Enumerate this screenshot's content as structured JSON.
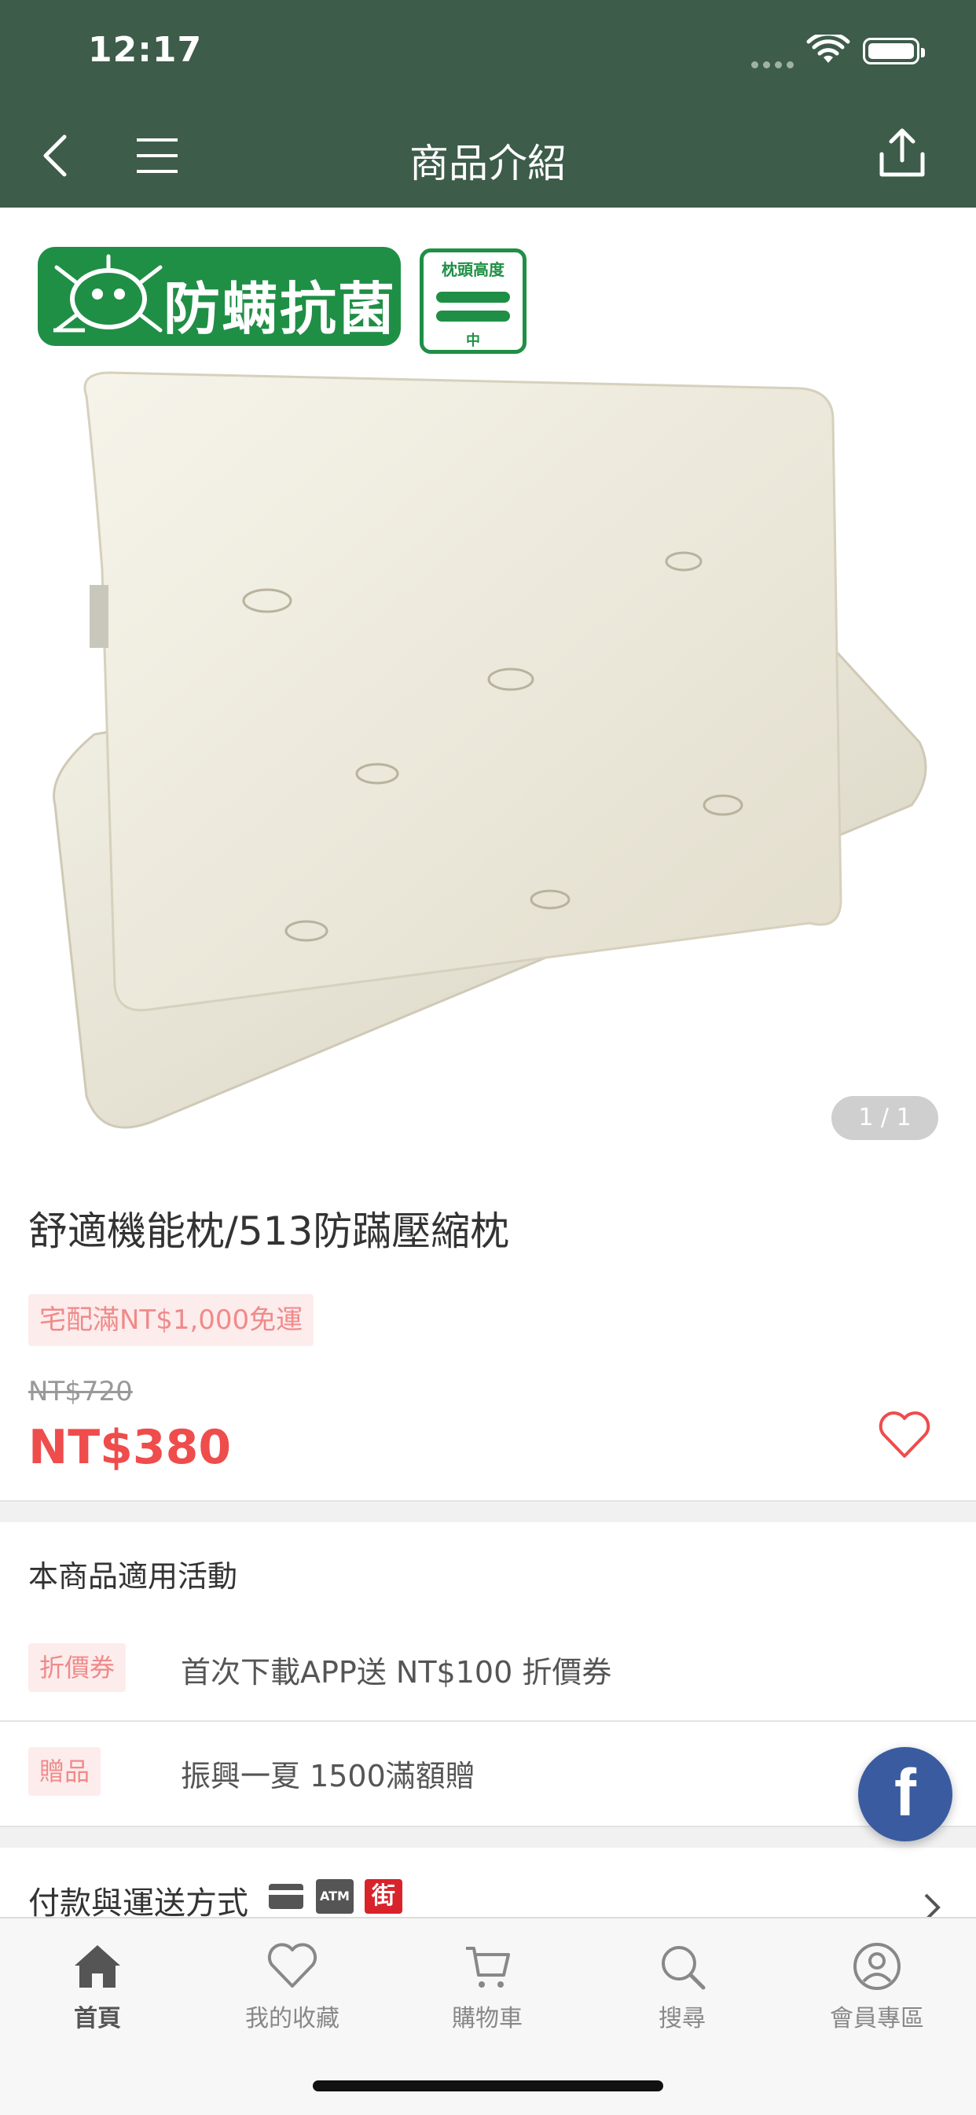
{
  "status_bar": {
    "time": "12:17"
  },
  "nav": {
    "title": "商品介紹",
    "icons": [
      "back-arrow-icon",
      "menu-icon",
      "share-icon"
    ]
  },
  "hero": {
    "badge_text": "防螨抗菌",
    "height_badge_title": "枕頭高度",
    "height_badge_value": "中",
    "page_indicator": "1 / 1"
  },
  "product": {
    "title": "舒適機能枕/513防蹣壓縮枕",
    "shipping_tag": "宅配滿NT$1,000免運",
    "original_price": "NT$720",
    "sale_price": "NT$380"
  },
  "promotions": {
    "header": "本商品適用活動",
    "items": [
      {
        "tag": "折價券",
        "text": "首次下載APP送 NT$100 折價券"
      },
      {
        "tag": "贈品",
        "text": "振興一夏 1500滿額贈"
      }
    ]
  },
  "payment": {
    "label": "付款與運送方式",
    "icons": [
      "credit-card-icon",
      "atm-icon",
      "street-store-icon"
    ],
    "atm_text": "ATM",
    "store_text": "街"
  },
  "facebook": {
    "letter": "f"
  },
  "tabbar": {
    "items": [
      {
        "label": "首頁",
        "icon": "home-icon",
        "active": true
      },
      {
        "label": "我的收藏",
        "icon": "heart-icon"
      },
      {
        "label": "購物車",
        "icon": "cart-icon"
      },
      {
        "label": "搜尋",
        "icon": "search-icon"
      },
      {
        "label": "會員專區",
        "icon": "user-icon"
      }
    ]
  },
  "colors": {
    "nav_bg": "#3d5c4a",
    "price_red": "#ef4c4c",
    "tag_bg": "#fdecec",
    "badge_green": "#1f8f45",
    "facebook_blue": "#3b5ba0"
  }
}
